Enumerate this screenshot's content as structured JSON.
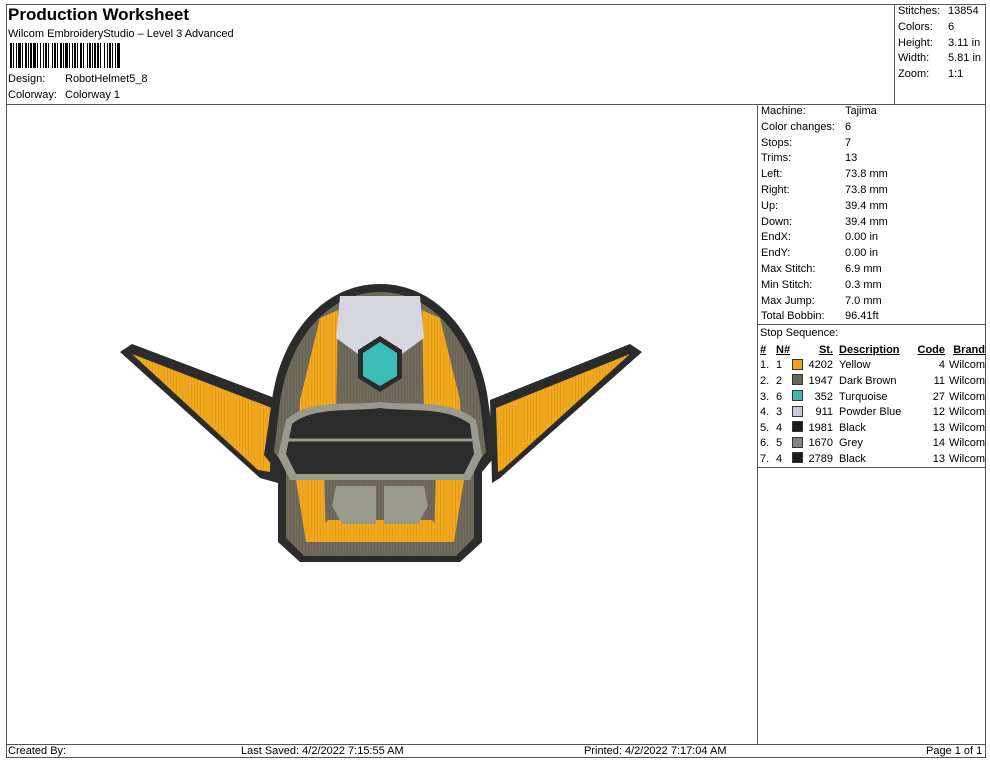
{
  "header": {
    "title": "Production Worksheet",
    "software": "Wilcom EmbroideryStudio – Level 3 Advanced",
    "design_label": "Design:",
    "design_value": "RobotHelmet5_8",
    "colorway_label": "Colorway:",
    "colorway_value": "Colorway 1"
  },
  "stats": [
    {
      "label": "Stitches:",
      "value": "13854"
    },
    {
      "label": "Colors:",
      "value": "6"
    },
    {
      "label": "Height:",
      "value": "3.11 in"
    },
    {
      "label": "Width:",
      "value": "5.81 in"
    },
    {
      "label": "Zoom:",
      "value": "1:1"
    }
  ],
  "machine_info": [
    {
      "label": "Machine:",
      "value": "Tajima"
    },
    {
      "label": "Color changes:",
      "value": "6"
    },
    {
      "label": "Stops:",
      "value": "7"
    },
    {
      "label": "Trims:",
      "value": "13"
    },
    {
      "label": "Left:",
      "value": "73.8 mm"
    },
    {
      "label": "Right:",
      "value": "73.8 mm"
    },
    {
      "label": "Up:",
      "value": "39.4 mm"
    },
    {
      "label": "Down:",
      "value": "39.4 mm"
    },
    {
      "label": "EndX:",
      "value": "0.00 in"
    },
    {
      "label": "EndY:",
      "value": "0.00 in"
    },
    {
      "label": "Max Stitch:",
      "value": "6.9 mm"
    },
    {
      "label": "Min Stitch:",
      "value": "0.3 mm"
    },
    {
      "label": "Max Jump:",
      "value": "7.0 mm"
    },
    {
      "label": "Total Bobbin:",
      "value": "96.41ft"
    }
  ],
  "stop_sequence": {
    "heading": "Stop Sequence:",
    "columns": {
      "num": "#",
      "n": "N#",
      "st": "St.",
      "description": "Description",
      "code": "Code",
      "brand": "Brand"
    },
    "rows": [
      {
        "num": "1.",
        "n": "1",
        "color": "#f0a21c",
        "st": "4202",
        "description": "Yellow",
        "code": "4",
        "brand": "Wilcom"
      },
      {
        "num": "2.",
        "n": "2",
        "color": "#6b6560",
        "st": "1947",
        "description": "Dark Brown",
        "code": "11",
        "brand": "Wilcom"
      },
      {
        "num": "3.",
        "n": "6",
        "color": "#3fb8b4",
        "st": "352",
        "description": "Turquoise",
        "code": "27",
        "brand": "Wilcom"
      },
      {
        "num": "4.",
        "n": "3",
        "color": "#c8c8d8",
        "st": "911",
        "description": "Powder Blue",
        "code": "12",
        "brand": "Wilcom"
      },
      {
        "num": "5.",
        "n": "4",
        "color": "#1c1c1c",
        "st": "1981",
        "description": "Black",
        "code": "13",
        "brand": "Wilcom"
      },
      {
        "num": "6.",
        "n": "5",
        "color": "#828282",
        "st": "1670",
        "description": "Grey",
        "code": "14",
        "brand": "Wilcom"
      },
      {
        "num": "7.",
        "n": "4",
        "color": "#1c1c1c",
        "st": "2789",
        "description": "Black",
        "code": "13",
        "brand": "Wilcom"
      }
    ]
  },
  "footer": {
    "created_by": "Created By:",
    "last_saved": "Last Saved: 4/2/2022 7:15:55 AM",
    "printed": "Printed: 4/2/2022 7:17:04 AM",
    "page": "Page 1 of 1"
  },
  "design_colors": {
    "yellow": "#f2a91e",
    "dark_brown": "#6f6a5c",
    "turquoise": "#3dbdb8",
    "powder_blue": "#d6d6de",
    "black": "#2b2b2b",
    "grey": "#9a9a8c"
  }
}
